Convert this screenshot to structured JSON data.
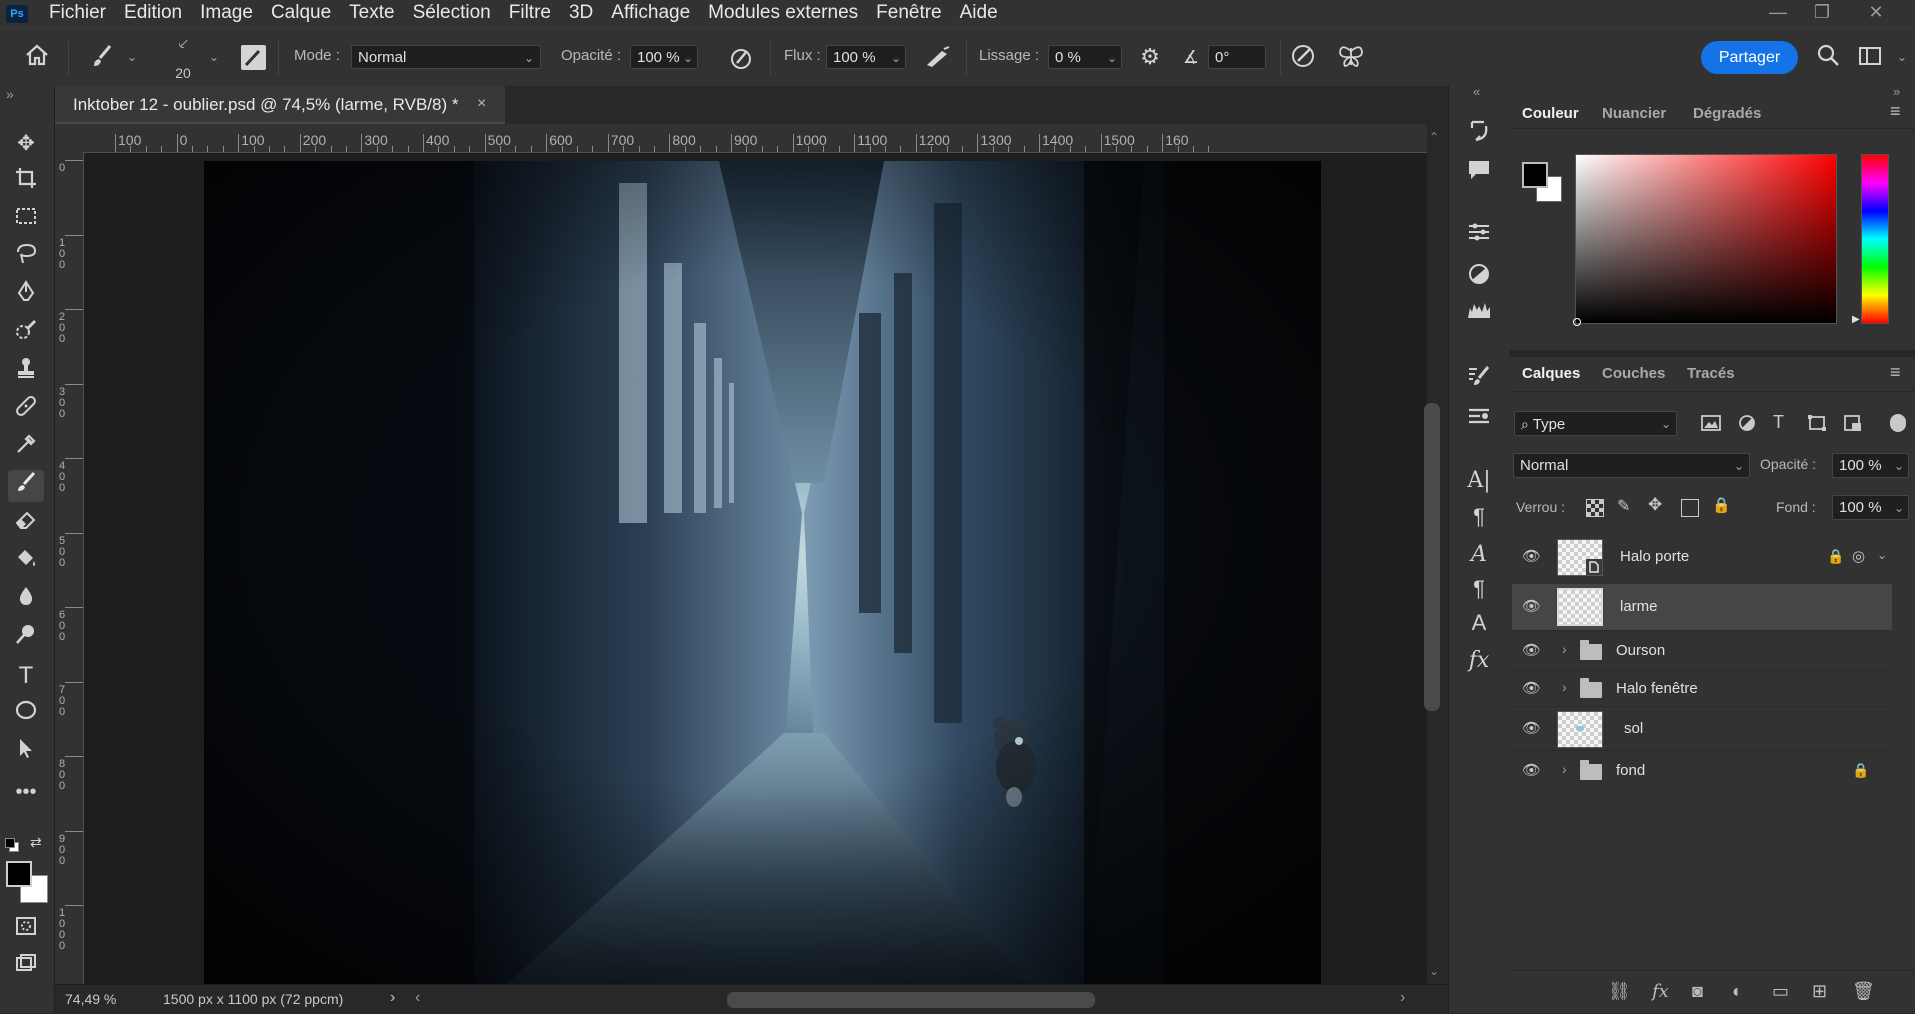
{
  "app": {
    "logo": "Ps"
  },
  "menu": [
    "Fichier",
    "Edition",
    "Image",
    "Calque",
    "Texte",
    "Sélection",
    "Filtre",
    "3D",
    "Affichage",
    "Modules externes",
    "Fenêtre",
    "Aide"
  ],
  "window_controls": {
    "minimize": "—",
    "restore": "❐",
    "close": "✕"
  },
  "options": {
    "brush_size": "20",
    "mode_label": "Mode :",
    "mode_value": "Normal",
    "opacity_label": "Opacité :",
    "opacity_value": "100 %",
    "flow_label": "Flux :",
    "flow_value": "100 %",
    "smoothing_label": "Lissage :",
    "smoothing_value": "0 %",
    "angle_value": "0°",
    "share_label": "Partager"
  },
  "document": {
    "tab_title": "Inktober 12 - oublier.psd @ 74,5% (larme, RVB/8) *",
    "close": "×",
    "ruler_top_labels": [
      "100",
      "0",
      "100",
      "200",
      "300",
      "400",
      "500",
      "600",
      "700",
      "800",
      "900",
      "1000",
      "1100",
      "1200",
      "1300",
      "1400",
      "1500",
      "160"
    ],
    "ruler_left_labels": [
      "0",
      "100",
      "200",
      "300",
      "400",
      "500",
      "600",
      "700",
      "800",
      "900",
      "1000"
    ]
  },
  "status": {
    "zoom": "74,49 %",
    "doc_size": "1500 px x 1100 px (72 ppcm)",
    "arrow": "›",
    "scroll_left": "‹",
    "scroll_right": "›"
  },
  "color_panel": {
    "tabs": [
      "Couleur",
      "Nuancier",
      "Dégradés"
    ],
    "foreground": "#000000",
    "background": "#ffffff",
    "hue": "#ff0000"
  },
  "layers_panel": {
    "tabs": [
      "Calques",
      "Couches",
      "Tracés"
    ],
    "filter_label": "Type",
    "blend_mode": "Normal",
    "opacity_label": "Opacité :",
    "opacity_value": "100 %",
    "lock_label": "Verrou :",
    "fill_label": "Fond :",
    "fill_value": "100 %",
    "layers": [
      {
        "name": "Halo porte",
        "kind": "smart",
        "visible": true,
        "locked": true
      },
      {
        "name": "larme",
        "kind": "pixel",
        "visible": true,
        "selected": true
      },
      {
        "name": "Ourson",
        "kind": "group",
        "visible": true
      },
      {
        "name": "Halo fenêtre",
        "kind": "group",
        "visible": true
      },
      {
        "name": "sol",
        "kind": "pixel",
        "visible": true
      },
      {
        "name": "fond",
        "kind": "group",
        "visible": true,
        "locked": true
      }
    ]
  },
  "colors": {
    "accent": "#1473e6",
    "panel_bg": "#323232",
    "app_bg": "#282828",
    "selected_layer": "#464646"
  }
}
